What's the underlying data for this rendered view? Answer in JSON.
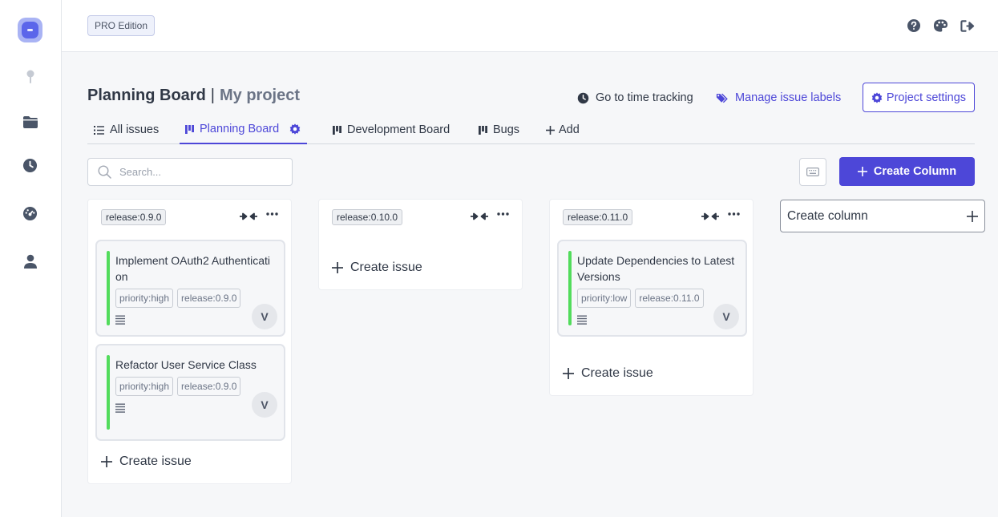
{
  "header": {
    "edition_badge": "PRO Edition"
  },
  "page": {
    "title": "Planning Board",
    "separator": "|",
    "project": "My project",
    "time_tracking_link": "Go to time tracking",
    "manage_labels_link": "Manage issue labels",
    "settings_button": "Project settings"
  },
  "tabs": [
    {
      "label": "All issues",
      "icon": "list-icon"
    },
    {
      "label": "Planning Board",
      "icon": "board-icon",
      "active": true
    },
    {
      "label": "Development Board",
      "icon": "board-icon"
    },
    {
      "label": "Bugs",
      "icon": "board-icon"
    },
    {
      "label": "Add",
      "icon": "plus-icon"
    }
  ],
  "toolbar": {
    "search_placeholder": "Search...",
    "create_column_button": "Create Column"
  },
  "columns": [
    {
      "label": "release:0.9.0",
      "create_issue": "Create issue",
      "cards": [
        {
          "title": "Implement OAuth2 Authentication",
          "labels": [
            "priority:high",
            "release:0.9.0"
          ],
          "assignee": "V"
        },
        {
          "title": "Refactor User Service Class",
          "labels": [
            "priority:high",
            "release:0.9.0"
          ],
          "assignee": "V"
        }
      ]
    },
    {
      "label": "release:0.10.0",
      "create_issue": "Create issue",
      "cards": []
    },
    {
      "label": "release:0.11.0",
      "create_issue": "Create issue",
      "cards": [
        {
          "title": "Update Dependencies to Latest Versions",
          "labels": [
            "priority:low",
            "release:0.11.0"
          ],
          "assignee": "V"
        }
      ]
    }
  ],
  "new_column": {
    "label": "Create column"
  },
  "colors": {
    "accent": "#4d47d8",
    "card_bar": "#52dc5c",
    "background": "#f6f7f9"
  }
}
